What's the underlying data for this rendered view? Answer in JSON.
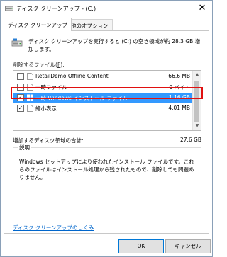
{
  "window": {
    "title": "ディスク クリーンアップ - (C:)",
    "close_glyph": "✕"
  },
  "tabs": [
    {
      "label": "ディスク クリーンアップ",
      "active": true
    },
    {
      "label": "その他のオプション",
      "active": false
    }
  ],
  "main": {
    "description": "ディスク クリーンアップを実行すると (C:) の空き領域が約 28.3 GB 増加します。",
    "files_label_prefix": "削除するファイル(",
    "files_label_key": "F",
    "files_label_suffix": "):",
    "files": [
      {
        "name": "RetailDemo Offline Content",
        "size": "66.6 MB",
        "checked": false,
        "selected": false,
        "icon": "file-icon"
      },
      {
        "name": "一時ファイル",
        "size": "0 バイト",
        "checked": false,
        "selected": false,
        "icon": "file-icon"
      },
      {
        "name": "一時 Windows インストール ファイル",
        "size": "1.16 GB",
        "checked": true,
        "selected": true,
        "icon": "windows-icon"
      },
      {
        "name": "縮小表示",
        "size": "4.01 MB",
        "checked": true,
        "selected": false,
        "icon": "file-icon"
      }
    ],
    "checkmark_glyph": "✓",
    "gain_label": "増加するディスク領域の合計:",
    "gain_value": "27.6 GB",
    "group_title": "説明",
    "group_text": "Windows セットアップにより使われたインストール ファイルです。これらのファイルはインストール処理から残されたもので、削除しても問題ありません。",
    "link_text": "ディスク クリーンアップのしくみ"
  },
  "buttons": {
    "ok_label": "OK",
    "cancel_label": "キャンセル"
  },
  "colors": {
    "selection": "#3399ff",
    "highlight_outline": "#e01010",
    "link": "#0066cc"
  }
}
